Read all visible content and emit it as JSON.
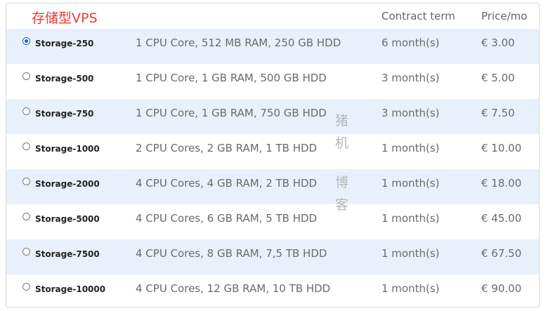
{
  "header": {
    "title": "存储型VPS",
    "contract_term_label": "Contract term",
    "price_label": "Price/mo"
  },
  "plans": [
    {
      "name": "Storage-250",
      "spec": "1 CPU Core, 512 MB RAM, 250 GB HDD",
      "term": "6 month(s)",
      "price": "€ 3.00",
      "selected": true
    },
    {
      "name": "Storage-500",
      "spec": "1 CPU Core, 1 GB RAM, 500 GB HDD",
      "term": "3 month(s)",
      "price": "€ 5.00",
      "selected": false
    },
    {
      "name": "Storage-750",
      "spec": "1 CPU Core, 1 GB RAM, 750 GB HDD",
      "term": "3 month(s)",
      "price": "€ 7.50",
      "selected": false
    },
    {
      "name": "Storage-1000",
      "spec": "2 CPU Cores, 2 GB RAM, 1 TB HDD",
      "term": "1 month(s)",
      "price": "€ 10.00",
      "selected": false
    },
    {
      "name": "Storage-2000",
      "spec": "4 CPU Cores, 4 GB RAM, 2 TB HDD",
      "term": "1 month(s)",
      "price": "€ 18.00",
      "selected": false
    },
    {
      "name": "Storage-5000",
      "spec": "4 CPU Cores, 6 GB RAM, 5 TB HDD",
      "term": "1 month(s)",
      "price": "€ 45.00",
      "selected": false
    },
    {
      "name": "Storage-7500",
      "spec": "4 CPU Cores, 8 GB RAM, 7,5 TB HDD",
      "term": "1 month(s)",
      "price": "€ 67.50",
      "selected": false
    },
    {
      "name": "Storage-10000",
      "spec": "4 CPU Cores, 12 GB RAM, 10 TB HDD",
      "term": "1 month(s)",
      "price": "€ 90.00",
      "selected": false
    }
  ],
  "watermark": [
    "猪",
    "机",
    "博",
    "客"
  ],
  "colors": {
    "title": "#e83a2e",
    "stripe": "#e8f1fb",
    "radio_selected": "#1a5fcc"
  }
}
